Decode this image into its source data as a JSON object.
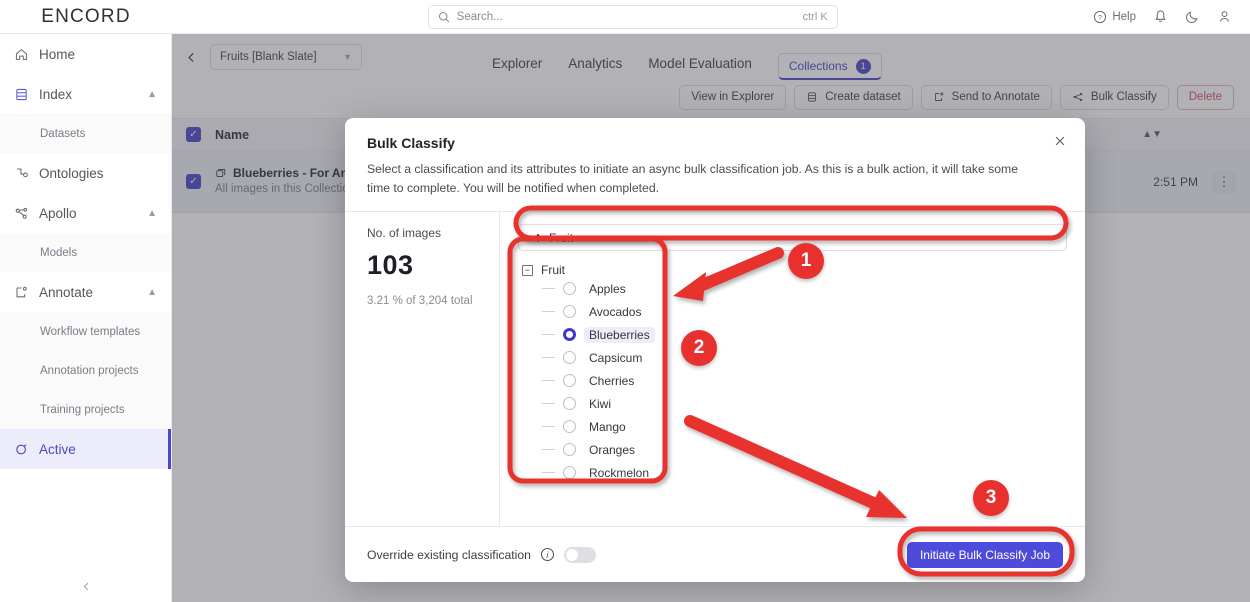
{
  "brand": {
    "name": "ENCORD"
  },
  "search": {
    "placeholder": "Search...",
    "shortcut": "ctrl K",
    "icon": "search-icon"
  },
  "topbar": {
    "help_label": "Help",
    "icons": [
      "help-circle-icon",
      "bell-icon",
      "moon-icon",
      "user-icon"
    ]
  },
  "sidebar": {
    "items": [
      {
        "label": "Home",
        "icon": "home-icon",
        "type": "item",
        "expandable": false,
        "active": false
      },
      {
        "label": "Index",
        "icon": "index-icon",
        "type": "item",
        "expandable": true,
        "active": false
      },
      {
        "label": "Datasets",
        "type": "sub"
      },
      {
        "label": "Ontologies",
        "icon": "ontology-icon",
        "type": "item",
        "expandable": false,
        "active": false
      },
      {
        "label": "Apollo",
        "icon": "apollo-icon",
        "type": "item",
        "expandable": true,
        "active": false
      },
      {
        "label": "Models",
        "type": "sub"
      },
      {
        "label": "Annotate",
        "icon": "annotate-icon",
        "type": "item",
        "expandable": true,
        "active": false
      },
      {
        "label": "Workflow templates",
        "type": "sub"
      },
      {
        "label": "Annotation projects",
        "type": "sub"
      },
      {
        "label": "Training projects",
        "type": "sub"
      },
      {
        "label": "Active",
        "icon": "active-icon",
        "type": "item",
        "expandable": false,
        "active": true
      }
    ],
    "collapse_icon": "chevron-left-icon"
  },
  "main": {
    "back_icon": "chevron-left-icon",
    "collection_select": {
      "value": "Fruits [Blank Slate]",
      "icon": "chevron-down-icon"
    },
    "tabs": [
      {
        "label": "Explorer",
        "selected": false
      },
      {
        "label": "Analytics",
        "selected": false
      },
      {
        "label": "Model Evaluation",
        "selected": false
      },
      {
        "label": "Collections",
        "selected": true,
        "badge": "1"
      }
    ],
    "toolbar": [
      {
        "label": "View in Explorer",
        "icon": null,
        "danger": false
      },
      {
        "label": "Create dataset",
        "icon": "dataset-icon",
        "danger": false
      },
      {
        "label": "Send to Annotate",
        "icon": "annotate-icon",
        "danger": false
      },
      {
        "label": "Bulk Classify",
        "icon": "share-nodes-icon",
        "danger": false
      },
      {
        "label": "Delete",
        "icon": null,
        "danger": true
      }
    ],
    "table": {
      "header": {
        "name": "Name",
        "sort_icon": "sort-icon"
      },
      "rows": [
        {
          "title": "Blueberries - For Annotation",
          "subtitle": "All images in this Collection need to be annotated.",
          "icon": "collection-icon",
          "time": "2:51 PM",
          "menu_icon": "kebab-icon"
        }
      ]
    }
  },
  "modal": {
    "title": "Bulk Classify",
    "description": "Select a classification and its attributes to initiate an async bulk classification job. As this is a bulk action, it will take some time to complete. You will be notified when completed.",
    "close_icon": "close-icon",
    "stats": {
      "label": "No. of images",
      "count": "103",
      "percent_text": "3.21 % of 3,204 total"
    },
    "classification_select": {
      "value": "Fruit",
      "icon": "share-nodes-icon",
      "chevron": "chevron-down-icon"
    },
    "tree": {
      "root_label": "Fruit",
      "root_toggle": "−",
      "options": [
        {
          "label": "Apples",
          "checked": false
        },
        {
          "label": "Avocados",
          "checked": false
        },
        {
          "label": "Blueberries",
          "checked": true
        },
        {
          "label": "Capsicum",
          "checked": false
        },
        {
          "label": "Cherries",
          "checked": false
        },
        {
          "label": "Kiwi",
          "checked": false
        },
        {
          "label": "Mango",
          "checked": false
        },
        {
          "label": "Oranges",
          "checked": false
        },
        {
          "label": "Rockmelon",
          "checked": false
        }
      ]
    },
    "footer": {
      "override_label": "Override existing classification",
      "info_icon": "info-icon",
      "toggle_on": false,
      "submit_label": "Initiate Bulk Classify Job"
    }
  },
  "annotations": {
    "color": "#e8302f",
    "steps": [
      {
        "number": "1"
      },
      {
        "number": "2"
      },
      {
        "number": "3"
      }
    ]
  },
  "colors": {
    "accent": "#4a49c6",
    "primary_button": "#4e4ada",
    "danger": "#d4545c",
    "annotation_red": "#e8302f"
  }
}
